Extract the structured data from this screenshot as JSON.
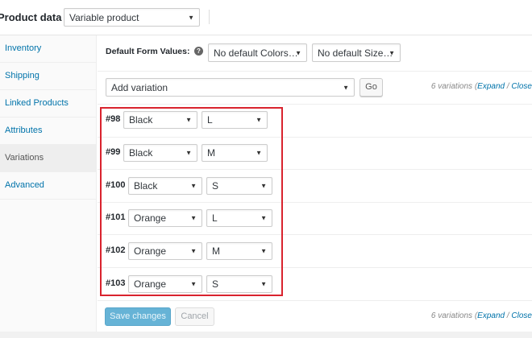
{
  "header": {
    "label": "Product data —",
    "product_type": "Variable product"
  },
  "sidebar": {
    "items": [
      {
        "label": "Inventory"
      },
      {
        "label": "Shipping"
      },
      {
        "label": "Linked Products"
      },
      {
        "label": "Attributes"
      },
      {
        "label": "Variations"
      },
      {
        "label": "Advanced"
      }
    ],
    "active": "Variations"
  },
  "defaults": {
    "label": "Default Form Values:",
    "colors": "No default Colors…",
    "sizes": "No default Size…"
  },
  "actions": {
    "add_variation": "Add variation",
    "go": "Go"
  },
  "summary": {
    "count": "6 variations (",
    "expand": "Expand",
    "sep": " / ",
    "close": "Close"
  },
  "variations": [
    {
      "id": "#98",
      "color": "Black",
      "size": "L"
    },
    {
      "id": "#99",
      "color": "Black",
      "size": "M"
    },
    {
      "id": "#100",
      "color": "Black",
      "size": "S"
    },
    {
      "id": "#101",
      "color": "Orange",
      "size": "L"
    },
    {
      "id": "#102",
      "color": "Orange",
      "size": "M"
    },
    {
      "id": "#103",
      "color": "Orange",
      "size": "S"
    }
  ],
  "footer": {
    "save": "Save changes",
    "cancel": "Cancel"
  },
  "colors": {
    "link": "#0073aa",
    "primary": "#66b3d6",
    "highlight": "#d9232e"
  }
}
